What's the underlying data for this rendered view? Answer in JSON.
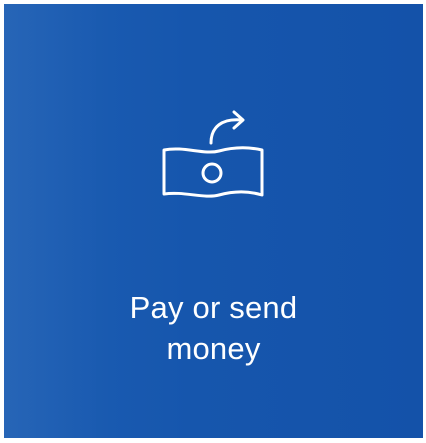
{
  "tile": {
    "label_line1": "Pay or send",
    "label_line2": "money",
    "icon": "send-money-icon",
    "background": "#1656ad",
    "foreground": "#ffffff"
  }
}
